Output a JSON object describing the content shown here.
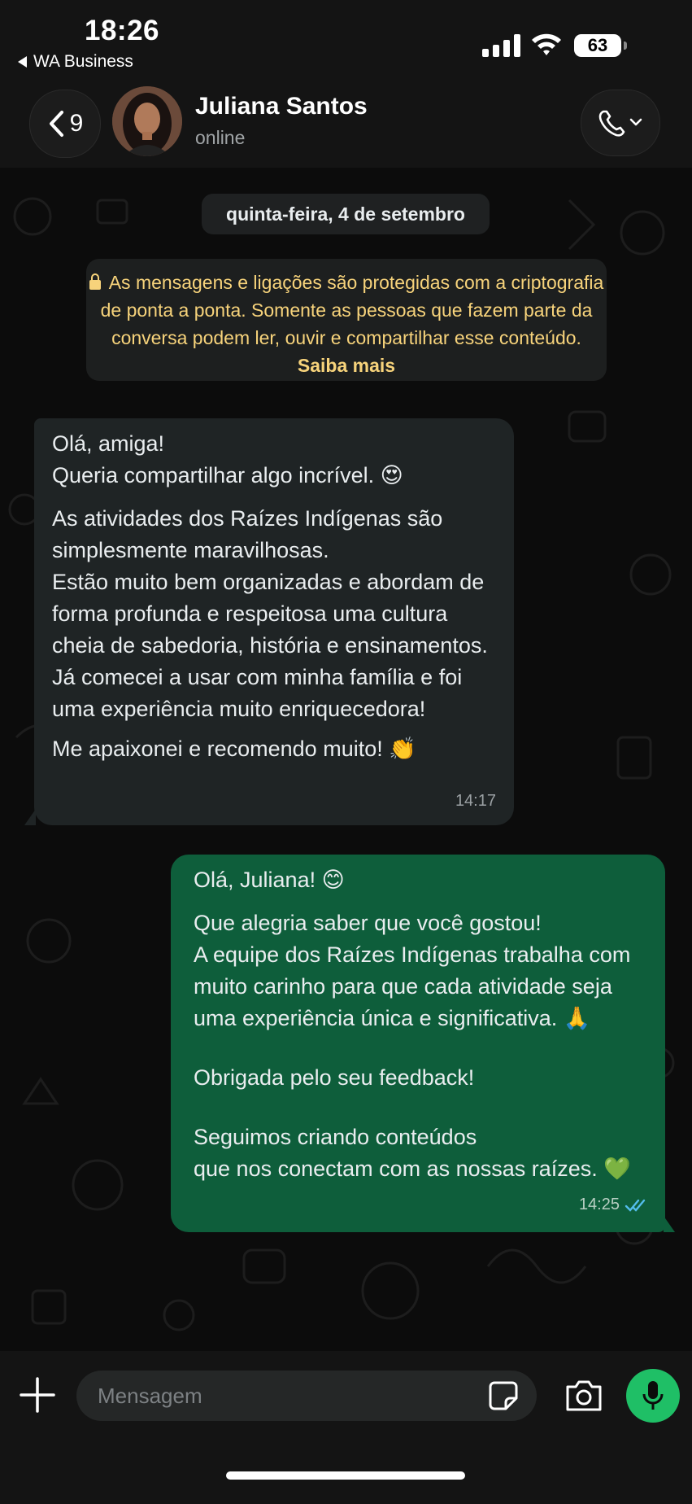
{
  "status": {
    "time": "18:26",
    "back_app": "WA Business",
    "battery": "63"
  },
  "header": {
    "back_count": "9",
    "name": "Juliana Santos",
    "status": "online"
  },
  "chat": {
    "date": "quinta-feira, 4 de setembro",
    "e2e_text": "As mensagens e ligações são protegidas com a criptografia de ponta a ponta. Somente as pessoas que fazem parte da conversa podem ler, ouvir e compartilhar esse conteúdo.",
    "e2e_link": "Saiba mais",
    "incoming": {
      "p1": "Olá, amiga!\nQueria compartilhar algo incrível. 😍",
      "p2": "As atividades dos Raízes Indígenas são simplesmente maravilhosas.\nEstão muito bem organizadas e abordam de forma profunda e respeitosa uma cultura cheia de sabedoria, história e ensinamentos. Já comecei a usar com minha família e foi uma experiência muito enriquecedora!",
      "p3": "Me apaixonei e recomendo muito! 👏",
      "time": "14:17"
    },
    "outgoing": {
      "p1": "Olá, Juliana! 😊",
      "p2": "Que alegria saber que você gostou!\nA equipe dos Raízes Indígenas trabalha com muito carinho para que cada atividade seja uma experiência única e significativa. 🙏",
      "p3": "Obrigada pelo seu feedback!",
      "p4": "Seguimos criando conteúdos\nque nos conectam com as nossas raízes. 💚",
      "time": "14:25"
    }
  },
  "input": {
    "placeholder": "Mensagem"
  },
  "colors": {
    "accent": "#1fbf66",
    "outgoing_bubble": "#0e5e3b",
    "incoming_bubble": "#1f2425",
    "e2e_text": "#f7d37b"
  }
}
